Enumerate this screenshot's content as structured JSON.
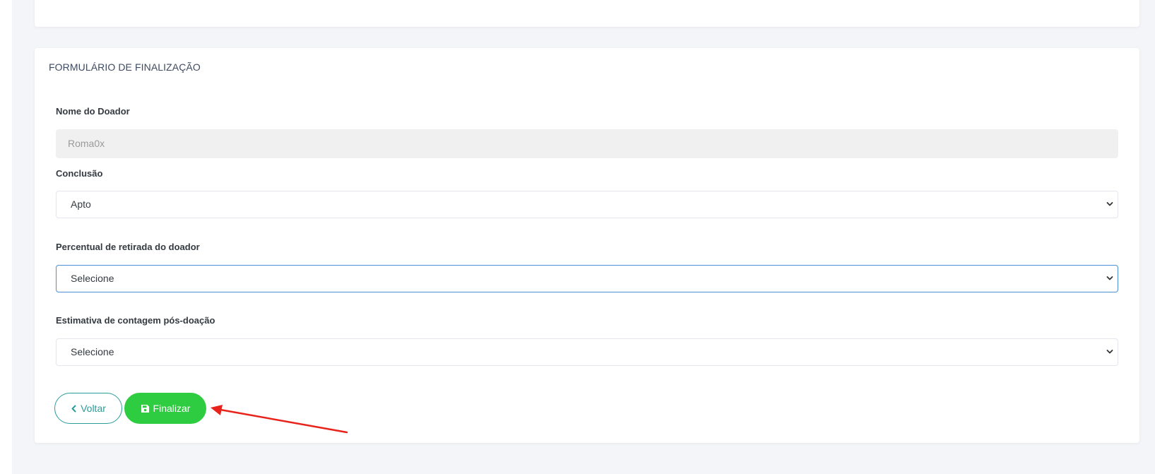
{
  "form": {
    "title": "FORMULÁRIO DE FINALIZAÇÃO",
    "donor_name": {
      "label": "Nome do Doador",
      "value": "Roma0x"
    },
    "conclusion": {
      "label": "Conclusão",
      "selected": "Apto"
    },
    "withdrawal_percentage": {
      "label": "Percentual de retirada do doador",
      "selected": "Selecione"
    },
    "post_donation_estimate": {
      "label": "Estimativa de contagem pós-doação",
      "selected": "Selecione"
    },
    "buttons": {
      "back_label": "Voltar",
      "finish_label": "Finalizar"
    }
  },
  "colors": {
    "accent_teal": "#2a9d9a",
    "finish_green": "#2ecc40",
    "annotation_red": "#e8231b",
    "focus_blue": "#4a90d9"
  },
  "icons": {
    "back": "chevron-left-icon",
    "finish": "save-icon",
    "select": "chevron-down-icon"
  }
}
